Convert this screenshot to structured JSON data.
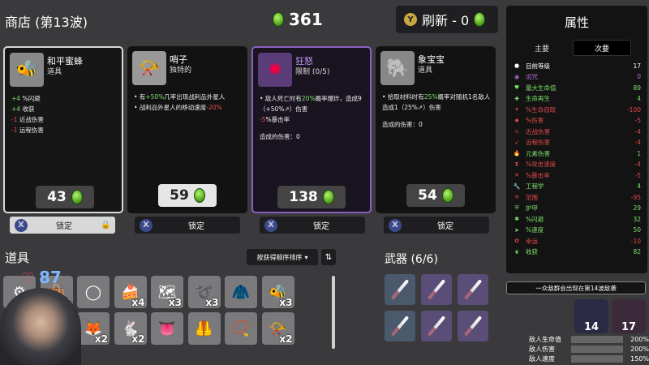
{
  "header": {
    "shop_title": "商店 (第13波)",
    "gold": "361",
    "reroll_label": "刷新 - 0",
    "reroll_button_glyph": "Y"
  },
  "shop_cards": [
    {
      "name": "和平蜜蜂",
      "type": "道具",
      "icon": "bee-icon",
      "lines": [
        {
          "value": "+4",
          "text": "%闪避",
          "color": "g"
        },
        {
          "value": "+4",
          "text": "收获",
          "color": "g"
        },
        {
          "value": "-1",
          "text": "近战伤害",
          "color": "r"
        },
        {
          "value": "-1",
          "text": "远程伤害",
          "color": "r"
        }
      ],
      "price": "43",
      "lock_label": "锁定",
      "lock_button_glyph": "X"
    },
    {
      "name": "哨子",
      "type": "独特的",
      "icon": "whistle-icon",
      "lines": [
        {
          "pre": "有",
          "value": "+50%",
          "text": "几率出现战利品外星人",
          "color": "g"
        },
        {
          "pre": "战利品外星人的移动速度",
          "value": "-20%",
          "text": "",
          "color": "r"
        }
      ],
      "price": "59",
      "lock_label": "锁定",
      "lock_button_glyph": "X"
    },
    {
      "name": "狂怒",
      "type": "限制 (0/5)",
      "icon": "rage-icon",
      "lines": [
        {
          "pre": "敌人死亡时有",
          "value": "20%",
          "text": "概率爆炸，造成9（+50%↗）伤害",
          "color": "g"
        },
        {
          "value": "-5",
          "text": "%暴击率",
          "color": "r"
        }
      ],
      "damage_label": "造成的伤害：0",
      "price": "138",
      "lock_label": "锁定",
      "lock_button_glyph": "X"
    },
    {
      "name": "象宝宝",
      "type": "道具",
      "icon": "baby-elephant-icon",
      "lines": [
        {
          "pre": "拾取材料时有",
          "value": "25%",
          "text": "概率对随机1名敌人造成1（25%↗）伤害",
          "color": "g"
        }
      ],
      "damage_label": "造成的伤害：0",
      "price": "54",
      "lock_label": "锁定",
      "lock_button_glyph": "X"
    }
  ],
  "items_section": {
    "title": "道具",
    "sort_label": "按获得顺序排序",
    "sort_dir_glyph": "⇅",
    "hp_value": "87",
    "items": [
      {
        "icon": "gear-icon",
        "count": ""
      },
      {
        "icon": "bag-icon",
        "count": "x2"
      },
      {
        "icon": "ring-icon",
        "count": ""
      },
      {
        "icon": "cake-icon",
        "count": "x4"
      },
      {
        "icon": "map-icon",
        "count": "x3"
      },
      {
        "icon": "claw-icon",
        "count": "x3"
      },
      {
        "icon": "jacket-icon",
        "count": ""
      },
      {
        "icon": "bee-icon",
        "count": "x3"
      },
      {
        "icon": "tree-icon",
        "count": ""
      },
      {
        "icon": "fox-icon",
        "count": "x2"
      },
      {
        "icon": "rabbit-icon",
        "count": "x2"
      },
      {
        "icon": "tongue-icon",
        "count": ""
      },
      {
        "icon": "vest-icon",
        "count": ""
      },
      {
        "icon": "necklace-icon",
        "count": ""
      },
      {
        "icon": "horn-icon",
        "count": "x2"
      }
    ]
  },
  "weapons_section": {
    "title": "武器 (6/6)",
    "weapons": [
      "dagger-icon",
      "dagger-icon",
      "dagger-icon",
      "dagger-icon",
      "dagger-icon",
      "dagger-icon"
    ]
  },
  "stats": {
    "title": "属性",
    "tab_primary": "主要",
    "tab_secondary": "次要",
    "rows": [
      {
        "name": "目前等级",
        "value": "17",
        "color": "#ffffff",
        "icon": "level-icon"
      },
      {
        "name": "诅咒",
        "value": "0",
        "color": "#b06ad8",
        "icon": "curse-icon"
      },
      {
        "name": "最大生命值",
        "value": "89",
        "color": "#7ee06c",
        "icon": "heart-icon"
      },
      {
        "name": "生命再生",
        "value": "4",
        "color": "#7ee06c",
        "icon": "regen-icon"
      },
      {
        "name": "%生命窃取",
        "value": "-100",
        "color": "#e04848",
        "icon": "lifesteal-icon"
      },
      {
        "name": "%伤害",
        "value": "-5",
        "color": "#e04848",
        "icon": "damage-icon"
      },
      {
        "name": "近战伤害",
        "value": "-4",
        "color": "#e04848",
        "icon": "melee-icon"
      },
      {
        "name": "远程伤害",
        "value": "-4",
        "color": "#e04848",
        "icon": "ranged-icon"
      },
      {
        "name": "元素伤害",
        "value": "1",
        "color": "#7ee06c",
        "icon": "elemental-icon"
      },
      {
        "name": "%攻击速度",
        "value": "-4",
        "color": "#e04848",
        "icon": "attack-speed-icon"
      },
      {
        "name": "%暴击率",
        "value": "-5",
        "color": "#e04848",
        "icon": "crit-icon"
      },
      {
        "name": "工程学",
        "value": "4",
        "color": "#7ee06c",
        "icon": "engineering-icon"
      },
      {
        "name": "范围",
        "value": "-95",
        "color": "#e04848",
        "icon": "range-icon"
      },
      {
        "name": "护甲",
        "value": "29",
        "color": "#7ee06c",
        "icon": "armor-icon"
      },
      {
        "name": "%闪避",
        "value": "32",
        "color": "#7ee06c",
        "icon": "dodge-icon"
      },
      {
        "name": "%速度",
        "value": "50",
        "color": "#7ee06c",
        "icon": "speed-icon"
      },
      {
        "name": "幸运",
        "value": "-10",
        "color": "#e04848",
        "icon": "luck-icon"
      },
      {
        "name": "收获",
        "value": "82",
        "color": "#7ee06c",
        "icon": "harvest-icon"
      }
    ]
  },
  "wave_info": {
    "banner": "一众敌群会出现在第14波敌袭",
    "enemies": [
      {
        "icon": "enemy-horde-icon",
        "count": "14"
      },
      {
        "icon": "enemy-elite-icon",
        "count": "17"
      }
    ],
    "modifiers": [
      {
        "name": "敌人生命值",
        "value": "200%"
      },
      {
        "name": "敌人伤害",
        "value": "200%"
      },
      {
        "name": "敌人速度",
        "value": "150%"
      }
    ]
  }
}
